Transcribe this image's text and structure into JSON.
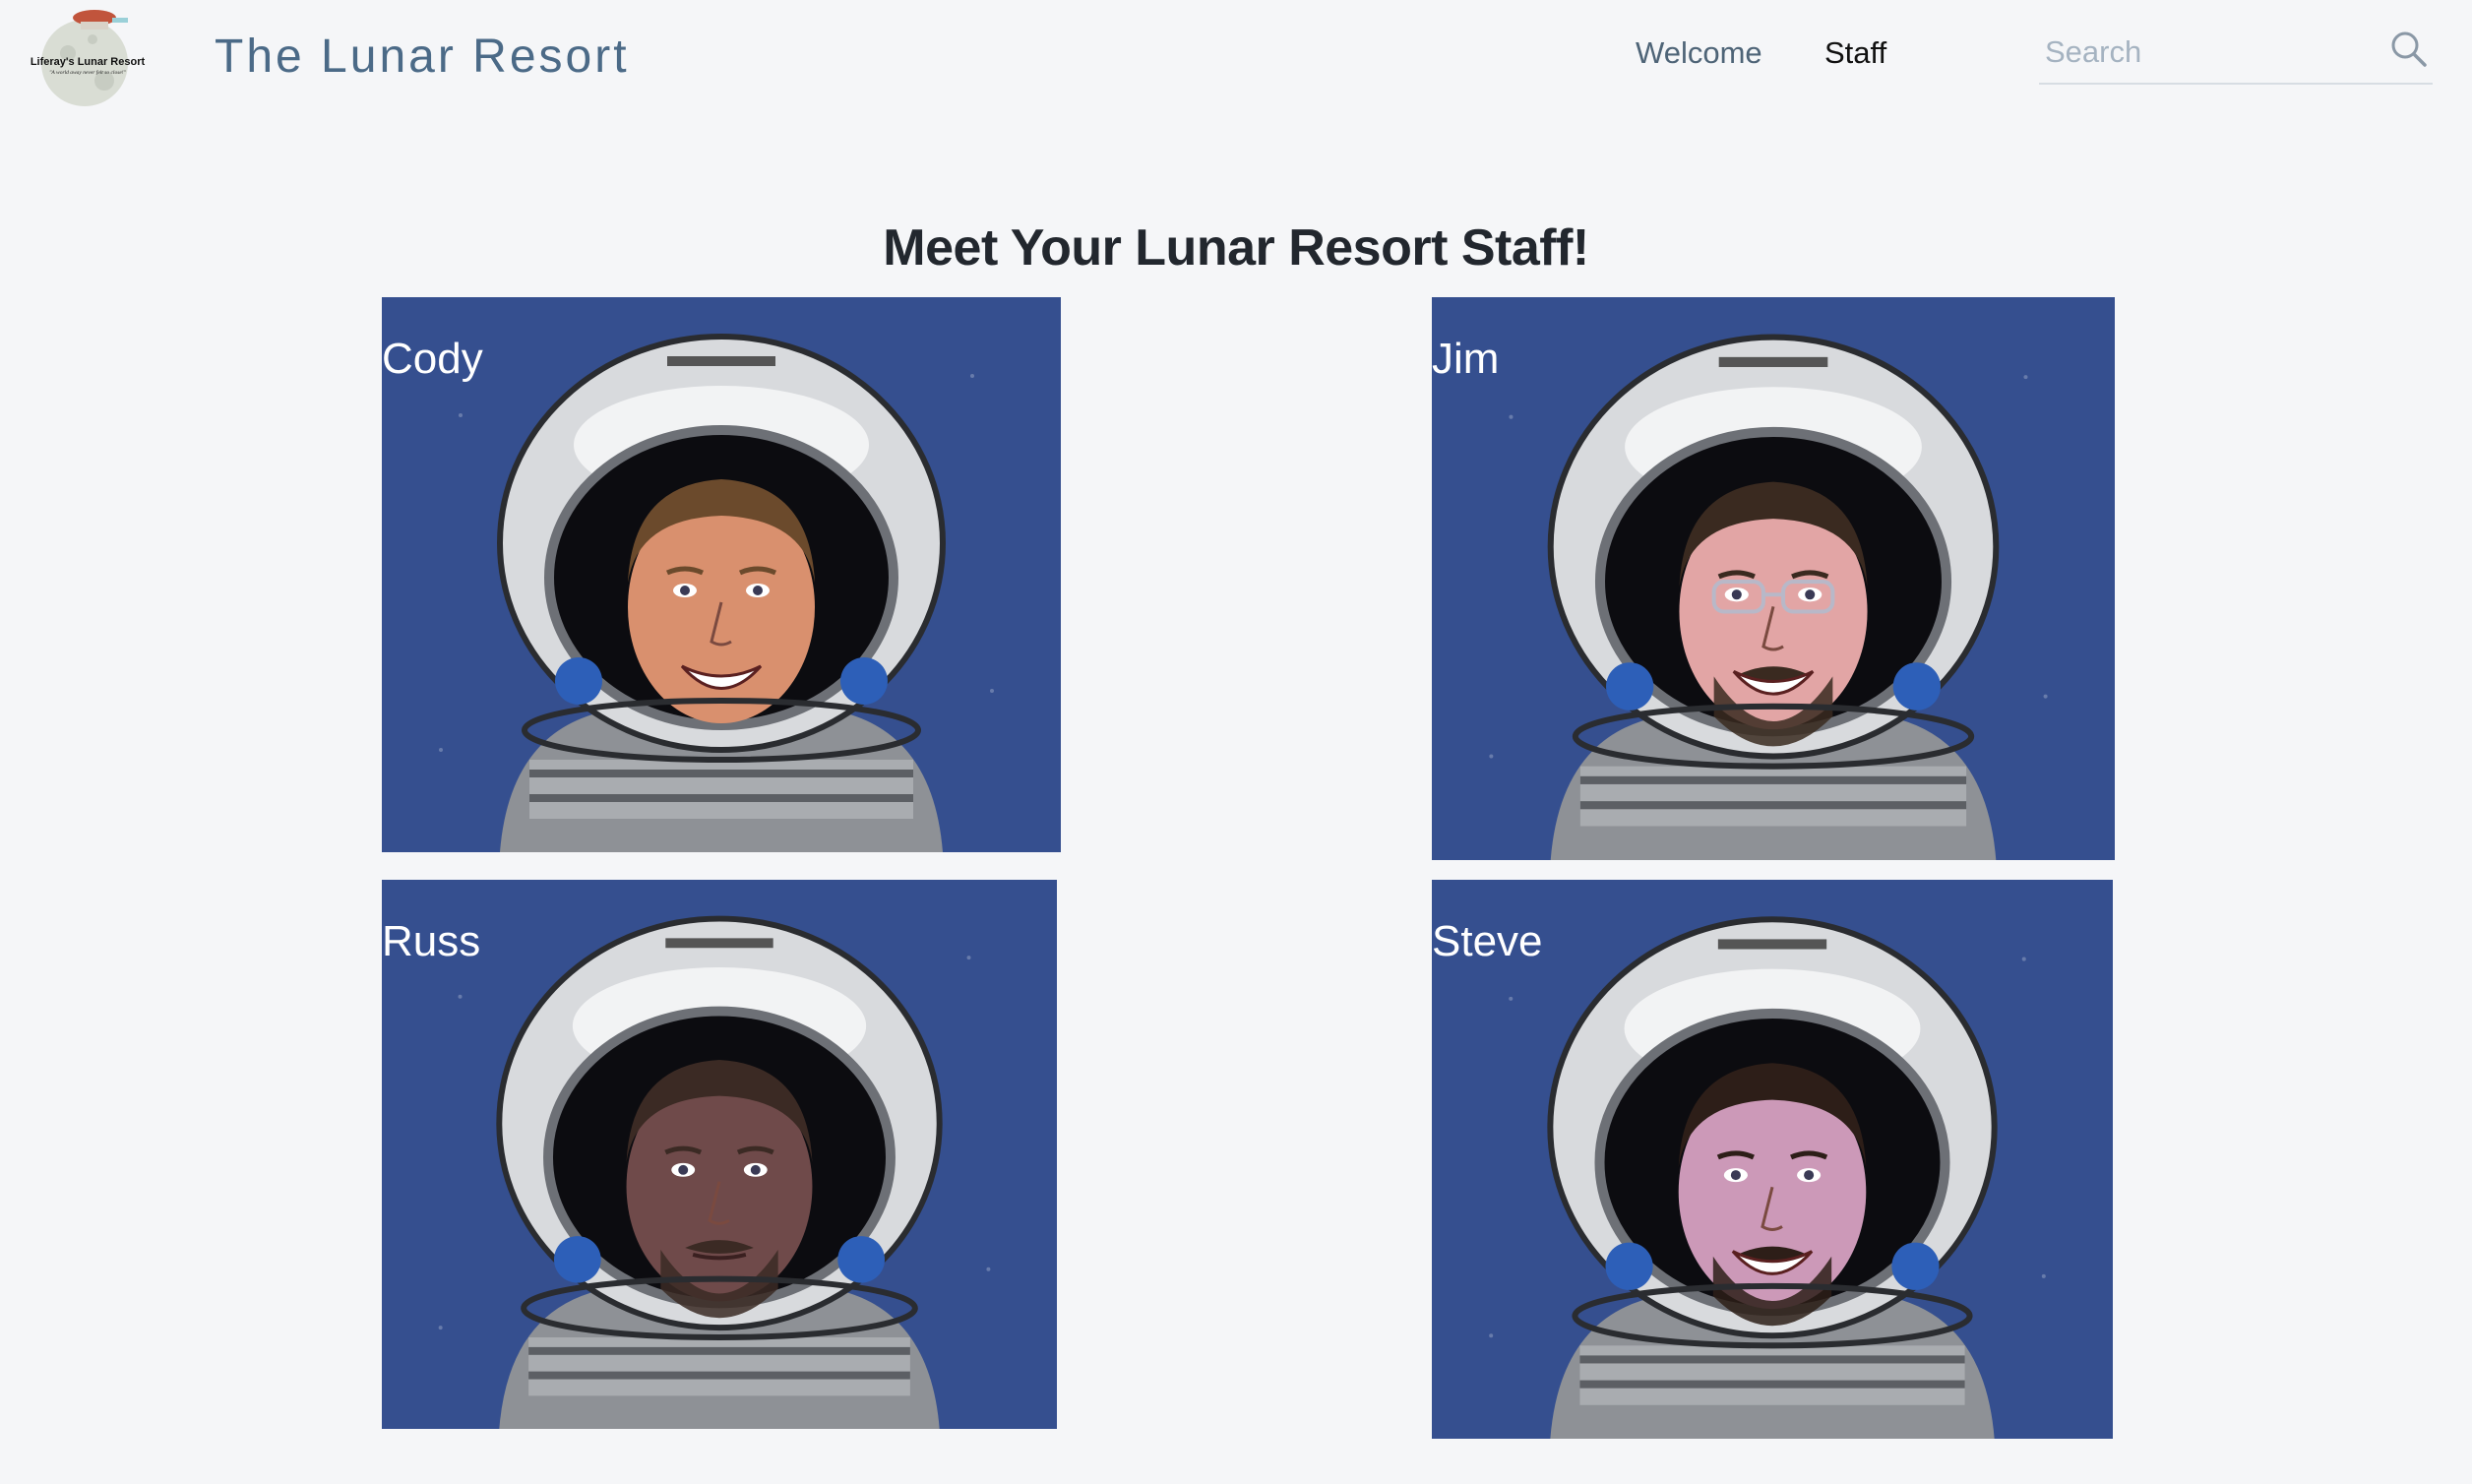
{
  "header": {
    "logo_title": "Liferay's Lunar Resort",
    "logo_tagline": "\"A world away never felt so close!\"",
    "site_title": "The Lunar Resort",
    "nav": [
      {
        "label": "Welcome"
      },
      {
        "label": "Staff"
      }
    ],
    "search": {
      "placeholder": "Search",
      "value": ""
    }
  },
  "main": {
    "title": "Meet Your Lunar Resort Staff!",
    "staff": [
      {
        "name": "Cody",
        "skin": "#d9906e",
        "hair": "#6b4a2c",
        "beard": false,
        "glasses": false,
        "expression": "smile"
      },
      {
        "name": "Jim",
        "skin": "#e2a5a5",
        "hair": "#3a2a20",
        "beard": true,
        "glasses": true,
        "expression": "smile"
      },
      {
        "name": "Russ",
        "skin": "#6f4a4a",
        "hair": "#3b2a24",
        "beard": true,
        "glasses": false,
        "expression": "neutral"
      },
      {
        "name": "Steve",
        "skin": "#cc99b8",
        "hair": "#2d1e18",
        "beard": true,
        "glasses": false,
        "expression": "smile"
      }
    ]
  },
  "colors": {
    "background": "#f5f6f8",
    "card_background": "#354f8f",
    "title_text": "#22272e",
    "site_title": "#4b6a87"
  }
}
